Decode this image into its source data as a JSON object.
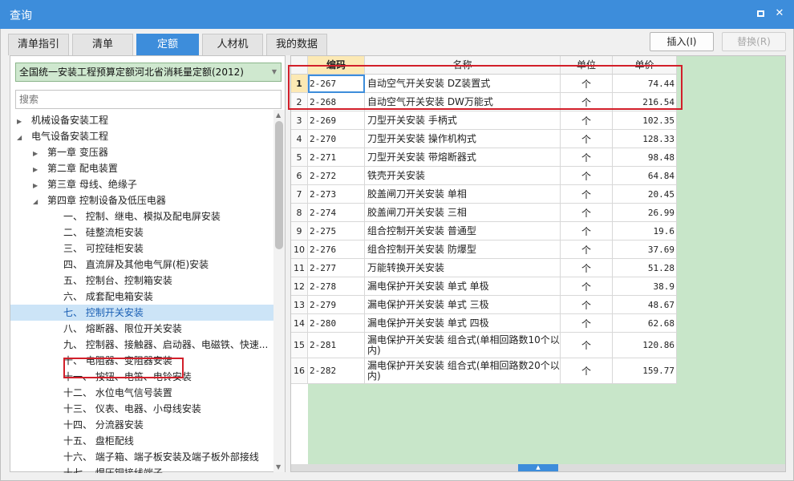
{
  "window": {
    "title": "查询"
  },
  "tabs": [
    {
      "label": "清单指引"
    },
    {
      "label": "清单"
    },
    {
      "label": "定额"
    },
    {
      "label": "人材机"
    },
    {
      "label": "我的数据"
    }
  ],
  "active_tab": "定额",
  "actions": {
    "insert_label": "插入(I)",
    "replace_label": "替换(R)"
  },
  "left": {
    "library_select": "全国统一安装工程预算定额河北省消耗量定额(2012)",
    "search_placeholder": "搜索",
    "tree": [
      {
        "label": "机械设备安装工程",
        "toggle": "▶"
      },
      {
        "label": "电气设备安装工程",
        "toggle": "◢"
      },
      {
        "label": "第一章 变压器",
        "toggle": "▶"
      },
      {
        "label": "第二章 配电装置",
        "toggle": "▶"
      },
      {
        "label": "第三章 母线、绝缘子",
        "toggle": "▶"
      },
      {
        "label": "第四章 控制设备及低压电器",
        "toggle": "◢"
      },
      {
        "label": "一、 控制、继电、模拟及配电屏安装",
        "toggle": ""
      },
      {
        "label": "二、 硅整流柜安装",
        "toggle": ""
      },
      {
        "label": "三、 可控硅柜安装",
        "toggle": ""
      },
      {
        "label": "四、 直流屏及其他电气屏(柜)安装",
        "toggle": ""
      },
      {
        "label": "五、 控制台、控制箱安装",
        "toggle": ""
      },
      {
        "label": "六、 成套配电箱安装",
        "toggle": ""
      },
      {
        "label": "七、 控制开关安装",
        "toggle": ""
      },
      {
        "label": "八、 熔断器、限位开关安装",
        "toggle": ""
      },
      {
        "label": "九、 控制器、接触器、启动器、电磁铁、快速...",
        "toggle": ""
      },
      {
        "label": "十、 电阻器、变阻器安装",
        "toggle": ""
      },
      {
        "label": "十一、 按钮、电笛、电铃安装",
        "toggle": ""
      },
      {
        "label": "十二、 水位电气信号装置",
        "toggle": ""
      },
      {
        "label": "十三、 仪表、电器、小母线安装",
        "toggle": ""
      },
      {
        "label": "十四、 分流器安装",
        "toggle": ""
      },
      {
        "label": "十五、 盘柜配线",
        "toggle": ""
      },
      {
        "label": "十六、 端子箱、端子板安装及端子板外部接线",
        "toggle": ""
      },
      {
        "label": "十七、 焊压铜接线端子",
        "toggle": ""
      }
    ],
    "selected_index": 12
  },
  "table": {
    "columns": {
      "code": "编码",
      "name": "名称",
      "unit": "单位",
      "price": "单价"
    },
    "rows": [
      {
        "rn": "1",
        "code": "2-267",
        "name": "自动空气开关安装 DZ装置式",
        "unit": "个",
        "price": "74.44"
      },
      {
        "rn": "2",
        "code": "2-268",
        "name": "自动空气开关安装 DW万能式",
        "unit": "个",
        "price": "216.54"
      },
      {
        "rn": "3",
        "code": "2-269",
        "name": "刀型开关安装 手柄式",
        "unit": "个",
        "price": "102.35"
      },
      {
        "rn": "4",
        "code": "2-270",
        "name": "刀型开关安装 操作机构式",
        "unit": "个",
        "price": "128.33"
      },
      {
        "rn": "5",
        "code": "2-271",
        "name": "刀型开关安装 带熔断器式",
        "unit": "个",
        "price": "98.48"
      },
      {
        "rn": "6",
        "code": "2-272",
        "name": "铁壳开关安装",
        "unit": "个",
        "price": "64.84"
      },
      {
        "rn": "7",
        "code": "2-273",
        "name": "胶盖闸刀开关安装 单相",
        "unit": "个",
        "price": "20.45"
      },
      {
        "rn": "8",
        "code": "2-274",
        "name": "胶盖闸刀开关安装 三相",
        "unit": "个",
        "price": "26.99"
      },
      {
        "rn": "9",
        "code": "2-275",
        "name": "组合控制开关安装 普通型",
        "unit": "个",
        "price": "19.6"
      },
      {
        "rn": "10",
        "code": "2-276",
        "name": "组合控制开关安装 防爆型",
        "unit": "个",
        "price": "37.69"
      },
      {
        "rn": "11",
        "code": "2-277",
        "name": "万能转换开关安装",
        "unit": "个",
        "price": "51.28"
      },
      {
        "rn": "12",
        "code": "2-278",
        "name": "漏电保护开关安装 单式 单极",
        "unit": "个",
        "price": "38.9"
      },
      {
        "rn": "13",
        "code": "2-279",
        "name": "漏电保护开关安装 单式 三极",
        "unit": "个",
        "price": "48.67"
      },
      {
        "rn": "14",
        "code": "2-280",
        "name": "漏电保护开关安装 单式 四极",
        "unit": "个",
        "price": "62.68"
      },
      {
        "rn": "15",
        "code": "2-281",
        "name": "漏电保护开关安装 组合式(单相回路数10个以内)",
        "unit": "个",
        "price": "120.86"
      },
      {
        "rn": "16",
        "code": "2-282",
        "name": "漏电保护开关安装 组合式(单相回路数20个以内)",
        "unit": "个",
        "price": "159.77"
      }
    ],
    "current_row": 0
  },
  "colors": {
    "accent": "#3d8ddb",
    "highlight_box": "#d21f2a",
    "grid_empty": "#c8e6c9",
    "library_select_bg": "#cfe8cf",
    "header_highlight": "#fce9b4"
  }
}
